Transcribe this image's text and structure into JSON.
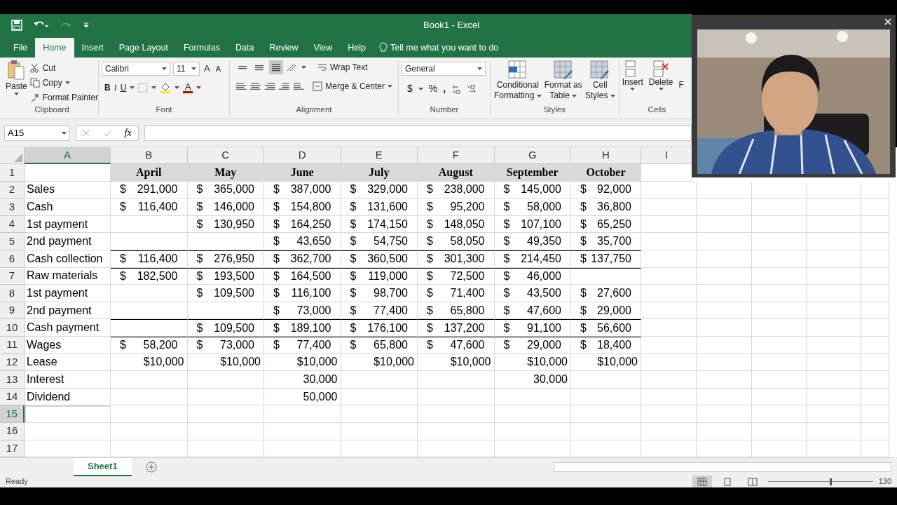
{
  "window": {
    "title": "Book1  -  Excel"
  },
  "menu_tabs": [
    {
      "label": "File",
      "selected": false
    },
    {
      "label": "Home",
      "selected": true
    },
    {
      "label": "Insert",
      "selected": false
    },
    {
      "label": "Page Layout",
      "selected": false
    },
    {
      "label": "Formulas",
      "selected": false
    },
    {
      "label": "Data",
      "selected": false
    },
    {
      "label": "Review",
      "selected": false
    },
    {
      "label": "View",
      "selected": false
    },
    {
      "label": "Help",
      "selected": false
    }
  ],
  "tell_me": "Tell me what you want to do",
  "ribbon": {
    "clipboard": {
      "label": "Clipboard",
      "paste": "Paste",
      "cut": "Cut",
      "copy": "Copy",
      "format_painter": "Format Painter"
    },
    "font": {
      "label": "Font",
      "family": "Calibri",
      "size": "11",
      "bold": "B",
      "italic": "I",
      "underline": "U",
      "grow": "A",
      "shrink": "A",
      "color_letter": "A"
    },
    "alignment": {
      "label": "Alignment",
      "vertical": [
        {
          "selected": false
        },
        {
          "selected": false
        },
        {
          "selected": true
        }
      ],
      "wrap": "Wrap Text",
      "merge": "Merge & Center"
    },
    "number": {
      "label": "Number",
      "format": "General",
      "currency": "$",
      "percent": "%",
      "comma": ","
    },
    "styles": {
      "label": "Styles",
      "buttons": [
        {
          "lines": [
            "Conditional",
            "Formatting"
          ]
        },
        {
          "lines": [
            "Format as",
            "Table"
          ]
        },
        {
          "lines": [
            "Cell",
            "Styles"
          ]
        }
      ]
    },
    "cells": {
      "label": "Cells",
      "buttons": [
        "Insert",
        "Delete",
        "F"
      ]
    }
  },
  "formula_bar": {
    "name_box": "A15",
    "fx": "fx"
  },
  "columns": [
    {
      "label": "A",
      "selected": true
    },
    {
      "label": "B",
      "selected": false
    },
    {
      "label": "C",
      "selected": false
    },
    {
      "label": "D",
      "selected": false
    },
    {
      "label": "E",
      "selected": false
    },
    {
      "label": "F",
      "selected": false
    },
    {
      "label": "G",
      "selected": false
    },
    {
      "label": "H",
      "selected": false
    },
    {
      "label": "I",
      "selected": false
    }
  ],
  "rows": [
    {
      "num": "1",
      "selected": false,
      "kind": "header",
      "rule_above": false,
      "cells": [
        null,
        "April",
        "May",
        "June",
        "July",
        "August",
        "September",
        "October"
      ]
    },
    {
      "num": "2",
      "selected": false,
      "kind": "data",
      "rule_above": false,
      "cells": [
        "Sales",
        {
          "sym": "$",
          "v": "291,000"
        },
        {
          "sym": "$",
          "v": "365,000"
        },
        {
          "sym": "$",
          "v": "387,000"
        },
        {
          "sym": "$",
          "v": "329,000"
        },
        {
          "sym": "$",
          "v": "238,000"
        },
        {
          "sym": "$",
          "v": "145,000"
        },
        {
          "sym": "$",
          "v": "92,000"
        }
      ]
    },
    {
      "num": "3",
      "selected": false,
      "kind": "data",
      "rule_above": false,
      "cells": [
        "Cash",
        {
          "sym": "$",
          "v": "116,400"
        },
        {
          "sym": "$",
          "v": "146,000"
        },
        {
          "sym": "$",
          "v": "154,800"
        },
        {
          "sym": "$",
          "v": "131,600"
        },
        {
          "sym": "$",
          "v": "95,200"
        },
        {
          "sym": "$",
          "v": "58,000"
        },
        {
          "sym": "$",
          "v": "36,800"
        }
      ]
    },
    {
      "num": "4",
      "selected": false,
      "kind": "data",
      "rule_above": false,
      "cells": [
        "1st payment",
        null,
        {
          "sym": "$",
          "v": "130,950"
        },
        {
          "sym": "$",
          "v": "164,250"
        },
        {
          "sym": "$",
          "v": "174,150"
        },
        {
          "sym": "$",
          "v": "148,050"
        },
        {
          "sym": "$",
          "v": "107,100"
        },
        {
          "sym": "$",
          "v": "65,250"
        }
      ]
    },
    {
      "num": "5",
      "selected": false,
      "kind": "data",
      "rule_above": false,
      "cells": [
        "2nd payment",
        null,
        null,
        {
          "sym": "$",
          "v": "43,650"
        },
        {
          "sym": "$",
          "v": "54,750"
        },
        {
          "sym": "$",
          "v": "58,050"
        },
        {
          "sym": "$",
          "v": "49,350"
        },
        {
          "sym": "$",
          "v": "35,700"
        }
      ]
    },
    {
      "num": "6",
      "selected": false,
      "kind": "data",
      "rule_above": true,
      "cells": [
        "Cash collection",
        {
          "sym": "$",
          "v": "116,400"
        },
        {
          "sym": "$",
          "v": "276,950"
        },
        {
          "sym": "$",
          "v": "362,700"
        },
        {
          "sym": "$",
          "v": "360,500"
        },
        {
          "sym": "$",
          "v": "301,300"
        },
        {
          "sym": "$",
          "v": "214,450"
        },
        {
          "sym": "$",
          "v": "137,750"
        }
      ]
    },
    {
      "num": "7",
      "selected": false,
      "kind": "data",
      "rule_above": true,
      "cells": [
        "Raw materials",
        {
          "sym": "$",
          "v": "182,500"
        },
        {
          "sym": "$",
          "v": "193,500"
        },
        {
          "sym": "$",
          "v": "164,500"
        },
        {
          "sym": "$",
          "v": "119,000"
        },
        {
          "sym": "$",
          "v": "72,500"
        },
        {
          "sym": "$",
          "v": "46,000"
        },
        null
      ]
    },
    {
      "num": "8",
      "selected": false,
      "kind": "data",
      "rule_above": false,
      "cells": [
        "1st payment",
        null,
        {
          "sym": "$",
          "v": "109,500"
        },
        {
          "sym": "$",
          "v": "116,100"
        },
        {
          "sym": "$",
          "v": "98,700"
        },
        {
          "sym": "$",
          "v": "71,400"
        },
        {
          "sym": "$",
          "v": "43,500"
        },
        {
          "sym": "$",
          "v": "27,600"
        }
      ]
    },
    {
      "num": "9",
      "selected": false,
      "kind": "data",
      "rule_above": false,
      "cells": [
        "2nd payment",
        null,
        null,
        {
          "sym": "$",
          "v": "73,000"
        },
        {
          "sym": "$",
          "v": "77,400"
        },
        {
          "sym": "$",
          "v": "65,800"
        },
        {
          "sym": "$",
          "v": "47,600"
        },
        {
          "sym": "$",
          "v": "29,000"
        }
      ]
    },
    {
      "num": "10",
      "selected": false,
      "kind": "data",
      "rule_above": true,
      "cells": [
        "Cash payment",
        null,
        {
          "sym": "$",
          "v": "109,500"
        },
        {
          "sym": "$",
          "v": "189,100"
        },
        {
          "sym": "$",
          "v": "176,100"
        },
        {
          "sym": "$",
          "v": "137,200"
        },
        {
          "sym": "$",
          "v": "91,100"
        },
        {
          "sym": "$",
          "v": "56,600"
        }
      ]
    },
    {
      "num": "11",
      "selected": false,
      "kind": "data",
      "rule_above": true,
      "cells": [
        "Wages",
        {
          "sym": "$",
          "v": "58,200"
        },
        {
          "sym": "$",
          "v": "73,000"
        },
        {
          "sym": "$",
          "v": "77,400"
        },
        {
          "sym": "$",
          "v": "65,800"
        },
        {
          "sym": "$",
          "v": "47,600"
        },
        {
          "sym": "$",
          "v": "29,000"
        },
        {
          "sym": "$",
          "v": "18,400"
        }
      ]
    },
    {
      "num": "12",
      "selected": false,
      "kind": "data",
      "rule_above": false,
      "cells": [
        "Lease",
        "$10,000",
        "$10,000",
        "$10,000",
        "$10,000",
        "$10,000",
        "$10,000",
        "$10,000"
      ]
    },
    {
      "num": "13",
      "selected": false,
      "kind": "data",
      "rule_above": false,
      "cells": [
        "Interest",
        null,
        null,
        "30,000",
        null,
        null,
        "30,000",
        null
      ]
    },
    {
      "num": "14",
      "selected": false,
      "kind": "data",
      "rule_above": false,
      "cells": [
        "Dividend",
        null,
        null,
        "50,000",
        null,
        null,
        null,
        null
      ]
    },
    {
      "num": "15",
      "selected": true,
      "kind": "data",
      "rule_above": false,
      "cells": [
        null,
        null,
        null,
        null,
        null,
        null,
        null,
        null
      ]
    },
    {
      "num": "16",
      "selected": false,
      "kind": "data",
      "rule_above": false,
      "cells": [
        null,
        null,
        null,
        null,
        null,
        null,
        null,
        null
      ]
    },
    {
      "num": "17",
      "selected": false,
      "kind": "data",
      "rule_above": false,
      "cells": [
        null,
        null,
        null,
        null,
        null,
        null,
        null,
        null
      ]
    }
  ],
  "sheet_tabs": [
    {
      "label": "Sheet1",
      "selected": true
    }
  ],
  "status_bar": {
    "status": "Ready",
    "views": [
      {
        "selected": true
      },
      {
        "selected": false
      },
      {
        "selected": false
      }
    ],
    "zoom_slider": {
      "level": 0.6
    },
    "zoom": "130"
  }
}
